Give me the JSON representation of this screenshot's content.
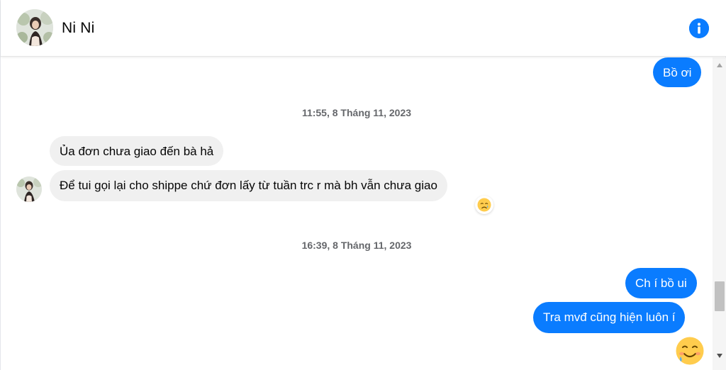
{
  "contact": {
    "name": "Ni Ni"
  },
  "header": {
    "info_icon": "info-icon"
  },
  "messages": [
    {
      "sender": "me",
      "text": "Bồ ơi"
    },
    {
      "type": "timestamp",
      "text": "11:55, 8 Tháng 11, 2023"
    },
    {
      "sender": "contact",
      "text": "Ủa đơn chưa giao đến bà hả"
    },
    {
      "sender": "contact",
      "text": "Để tui gọi lại cho shippe chứ đơn lấy từ tuần trc r mà bh vẫn chưa giao",
      "reaction": "crying-face"
    },
    {
      "type": "timestamp",
      "text": "16:39, 8 Tháng 11, 2023"
    },
    {
      "sender": "me",
      "text": "Ch í bồ ui"
    },
    {
      "sender": "me",
      "text": "Tra mvđ cũng hiện luôn í"
    },
    {
      "sender": "me",
      "sticker": "smiling-face-with-tear"
    }
  ],
  "colors": {
    "outgoing_bubble": "#0a7cff",
    "incoming_bubble": "#f0f0f0",
    "timestamp_text": "#65676b",
    "info_icon": "#0a7cff"
  }
}
